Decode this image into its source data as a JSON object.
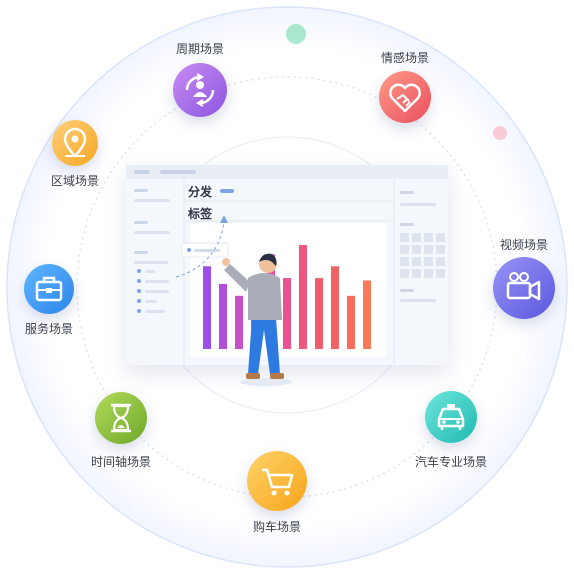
{
  "center": {
    "tag_fenfa": "分发",
    "tag_biaoqian": "标签"
  },
  "scenarios": [
    {
      "id": "periodic",
      "label": "周期场景",
      "icon": "cycle-person-icon",
      "color_from": "#c98bf2",
      "color_to": "#8b56e0"
    },
    {
      "id": "emotion",
      "label": "情感场景",
      "icon": "handshake-heart-icon",
      "color_from": "#ff9a88",
      "color_to": "#ea4f5f"
    },
    {
      "id": "region",
      "label": "区域场景",
      "icon": "map-pin-icon",
      "color_from": "#ffd07a",
      "color_to": "#f5a623"
    },
    {
      "id": "video",
      "label": "视频场景",
      "icon": "video-camera-icon",
      "color_from": "#9a94f7",
      "color_to": "#5a57de"
    },
    {
      "id": "service",
      "label": "服务场景",
      "icon": "briefcase-icon",
      "color_from": "#5fb6ff",
      "color_to": "#2c84ea"
    },
    {
      "id": "timeline",
      "label": "时间轴场景",
      "icon": "hourglass-icon",
      "color_from": "#b3da5c",
      "color_to": "#6ea829"
    },
    {
      "id": "auto",
      "label": "汽车专业场景",
      "icon": "car-icon",
      "color_from": "#6ee6da",
      "color_to": "#20b9b2"
    },
    {
      "id": "shopping",
      "label": "购车场景",
      "icon": "shopping-cart-icon",
      "color_from": "#ffd36a",
      "color_to": "#f7a419"
    }
  ],
  "bar_chart": {
    "values": [
      70,
      55,
      45,
      62,
      80,
      60,
      88,
      60,
      70,
      45,
      58
    ],
    "colors": [
      "#9c4fe8",
      "#b24fd9",
      "#c74fc9",
      "#d64fb8",
      "#e24fa5",
      "#ea5191",
      "#ee557f",
      "#f05b70",
      "#f36264",
      "#f76c5b",
      "#fa7956"
    ]
  },
  "colors": {
    "ring": "#dbe4fb",
    "dashed": "#d5dcec",
    "accent_dot_green": "#a9e8cf",
    "accent_dot_pink": "#f8cbd7"
  }
}
